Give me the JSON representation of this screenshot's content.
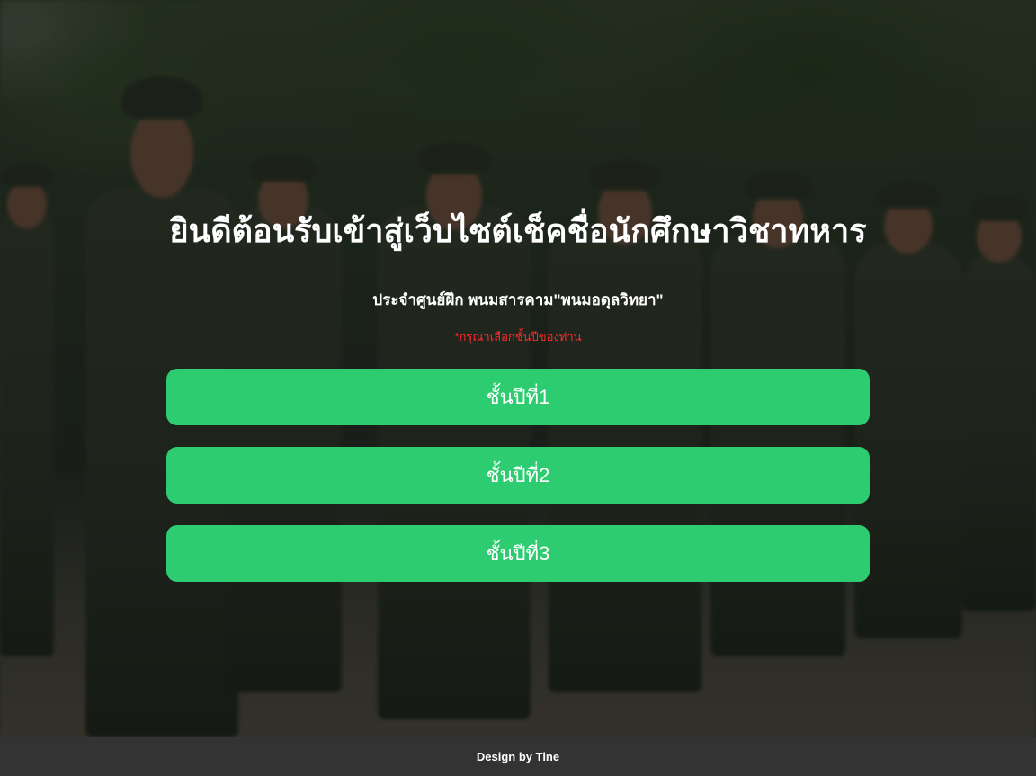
{
  "header": {
    "title": "ยินดีต้อนรับเข้าสู่เว็บไซต์เช็คชื่อนักศึกษาวิชาทหาร",
    "subtitle": "ประจำศูนย์ฝึก พนมสารคาม\"พนมอดุลวิทยา\"",
    "hint": "*กรุณาเลือกชั้นปีของท่าน"
  },
  "year_buttons": [
    {
      "label": "ชั้นปีที่1"
    },
    {
      "label": "ชั้นปีที่2"
    },
    {
      "label": "ชั้นปีที่3"
    }
  ],
  "footer": {
    "text": "Design by Tine"
  },
  "colors": {
    "button_bg": "#2ecc71",
    "hint_text": "#ff2a2a",
    "footer_bg": "#333333",
    "text": "#ffffff"
  }
}
